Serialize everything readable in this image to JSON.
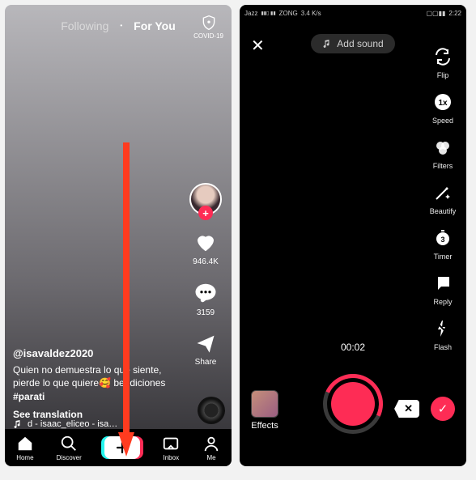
{
  "colors": {
    "accent": "#fe2c55",
    "cyan": "#25f4ee"
  },
  "feed": {
    "tabs": {
      "following": "Following",
      "foryou": "For You"
    },
    "covid_label": "COVID-19",
    "username": "@isavaldez2020",
    "caption_line1": "Quien no demuestra lo que siente,",
    "caption_line2": "pierde lo que quiere🥰 bendiciones",
    "hashtag": "#parati",
    "see_translation": "See translation",
    "sound": "d - isaac_eliceo - isa…",
    "likes": "946.4K",
    "comments": "3159",
    "share": "Share",
    "nav": {
      "home": "Home",
      "discover": "Discover",
      "inbox": "Inbox",
      "me": "Me"
    }
  },
  "record": {
    "statusbar": {
      "carrier": "Jazz",
      "carrier2": "ZONG",
      "rate": "3.4 K/s",
      "time": "2:22"
    },
    "add_sound": "Add sound",
    "tools": {
      "flip": "Flip",
      "speed": "Speed",
      "filters": "Filters",
      "beautify": "Beautify",
      "timer": "Timer",
      "reply": "Reply",
      "flash": "Flash"
    },
    "timer": "00:02",
    "effects": "Effects",
    "delete": "✕",
    "confirm": "✓"
  }
}
